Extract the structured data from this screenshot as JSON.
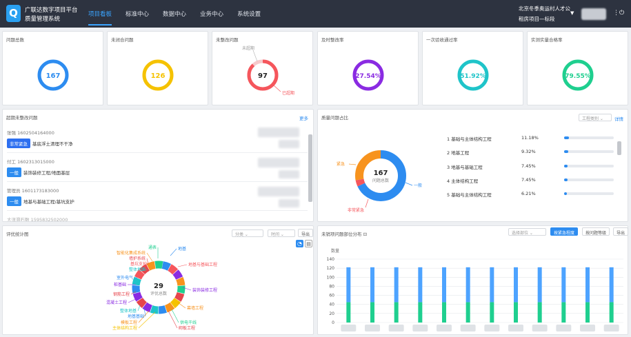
{
  "header": {
    "brand_line1": "广联达数字项目平台",
    "brand_line2": "质量管理系统",
    "logo_letter": "Q",
    "nav": [
      {
        "label": "项目看板",
        "active": true
      },
      {
        "label": "标准中心",
        "active": false
      },
      {
        "label": "数据中心",
        "active": false
      },
      {
        "label": "业务中心",
        "active": false
      },
      {
        "label": "系统设置",
        "active": false
      }
    ],
    "org": "北京冬季奥运村人才公",
    "project": "租房项目—标段"
  },
  "kpis": [
    {
      "title": "问题总数",
      "value": "167",
      "color": "#2d8cf0",
      "progress": 1.0
    },
    {
      "title": "未闭合问题",
      "value": "126",
      "color": "#f5c200",
      "progress": 1.0
    },
    {
      "title": "未整改问题",
      "value": "97",
      "color": "#f5565c",
      "progress": 0.88,
      "label_unexpired": "未超期",
      "label_expired": "已超期"
    },
    {
      "title": "及时整改率",
      "value": "27.54%",
      "color": "#8a2be2",
      "progress": 1.0
    },
    {
      "title": "一次验收通过率",
      "value": "51.92%",
      "color": "#1fc4c9",
      "progress": 1.0
    },
    {
      "title": "实测实量合格率",
      "value": "79.55%",
      "color": "#1fcf8f",
      "progress": 1.0
    }
  ],
  "overdue": {
    "title": "超期未整改问题",
    "more": "更多",
    "items": [
      {
        "who": "张强 1602504164000",
        "tag": "非常紧急",
        "tag_type": "urgent",
        "desc": "基底浮土清理不干净"
      },
      {
        "who": "付工 1602313015000",
        "tag": "一般",
        "tag_type": "normal",
        "desc": "装饰装修工程/地面基层"
      },
      {
        "who": "管理员 1601173183000",
        "tag": "一般",
        "tag_type": "normal",
        "desc": "地基与基础工程/基坑支护"
      },
      {
        "who": "大洋滑石数 1595832502000",
        "tag": "",
        "tag_type": "normal",
        "desc": ""
      }
    ]
  },
  "quality_share": {
    "title": "质量问题占比",
    "filter": "工程类别",
    "detail": "详情",
    "center_value": "167",
    "center_label": "问题总数",
    "segments": [
      {
        "name": "一般",
        "share": 0.68,
        "color": "#2d8cf0"
      },
      {
        "name": "非常紧急",
        "share": 0.04,
        "color": "#f5565c"
      },
      {
        "name": "紧急",
        "share": 0.28,
        "color": "#f7931e"
      }
    ],
    "ranking": [
      {
        "name": "1 基础与主体结构工程",
        "pct": "11.18%",
        "value": 0.1118
      },
      {
        "name": "2 地基工程",
        "pct": "9.32%",
        "value": 0.0932
      },
      {
        "name": "3 地基与基础工程",
        "pct": "7.45%",
        "value": 0.0745
      },
      {
        "name": "4 主体结构工程",
        "pct": "7.45%",
        "value": 0.0745
      },
      {
        "name": "5 基础与主体结构工程",
        "pct": "6.21%",
        "value": 0.0621
      }
    ]
  },
  "eval": {
    "title": "评优统计图",
    "sel_category": "分类",
    "sel_time": "时间",
    "export": "导出",
    "center_value": "29",
    "center_label": "评优总数",
    "segments": [
      {
        "name": "地基",
        "color": "#2d8cf0"
      },
      {
        "name": "地基与基础工程",
        "color": "#f5565c"
      },
      {
        "name": "装饰装修工程",
        "color": "#8a2be2"
      },
      {
        "name": "幕墙工程",
        "color": "#f7931e"
      },
      {
        "name": "供电干线",
        "color": "#1fcf8f"
      },
      {
        "name": "砌板工程",
        "color": "#e6454c"
      },
      {
        "name": "主体结构工程",
        "color": "#f5c200"
      },
      {
        "name": "模板工程",
        "color": "#f7931e"
      },
      {
        "name": "地基基础",
        "color": "#2d8cf0"
      },
      {
        "name": "整体地基",
        "color": "#1fc4c9"
      },
      {
        "name": "混凝土工程",
        "color": "#8a2be2"
      },
      {
        "name": "钢筋工程",
        "color": "#e6454c"
      },
      {
        "name": "桩基础",
        "color": "#8a2be2"
      },
      {
        "name": "室外电气",
        "color": "#2d8cf0"
      },
      {
        "name": "整体地面",
        "color": "#1fc4c9"
      },
      {
        "name": "基坑支护",
        "color": "#f5565c"
      },
      {
        "name": "墙护系统",
        "color": "#e6454c"
      },
      {
        "name": "智能化集成系统",
        "color": "#f7931e"
      },
      {
        "name": "通表",
        "color": "#1fcf8f"
      }
    ]
  },
  "dist": {
    "title": "未销项问题部位分布",
    "title_suffix": "⊡",
    "sel_region": "选择部位",
    "btn_severity": "按紧急程度",
    "btn_level": "按问题等级",
    "export": "导出",
    "ylabel": "数量"
  },
  "chart_data": {
    "type": "bar",
    "stacked": true,
    "ylabel": "数量",
    "ylim": [
      0,
      140
    ],
    "yticks": [
      0,
      20,
      40,
      60,
      80,
      100,
      120,
      140
    ],
    "categories": [
      "",
      "",
      "",
      "",
      "",
      "",
      "",
      "",
      "",
      "",
      "",
      ""
    ],
    "series": [
      {
        "color": "#1fcf8f",
        "values": [
          45,
          45,
          45,
          45,
          45,
          45,
          45,
          45,
          45,
          45,
          45,
          45
        ]
      },
      {
        "color": "#4da3ff",
        "values": [
          77,
          77,
          77,
          77,
          77,
          77,
          77,
          77,
          77,
          77,
          77,
          77
        ]
      }
    ],
    "grid": true
  }
}
